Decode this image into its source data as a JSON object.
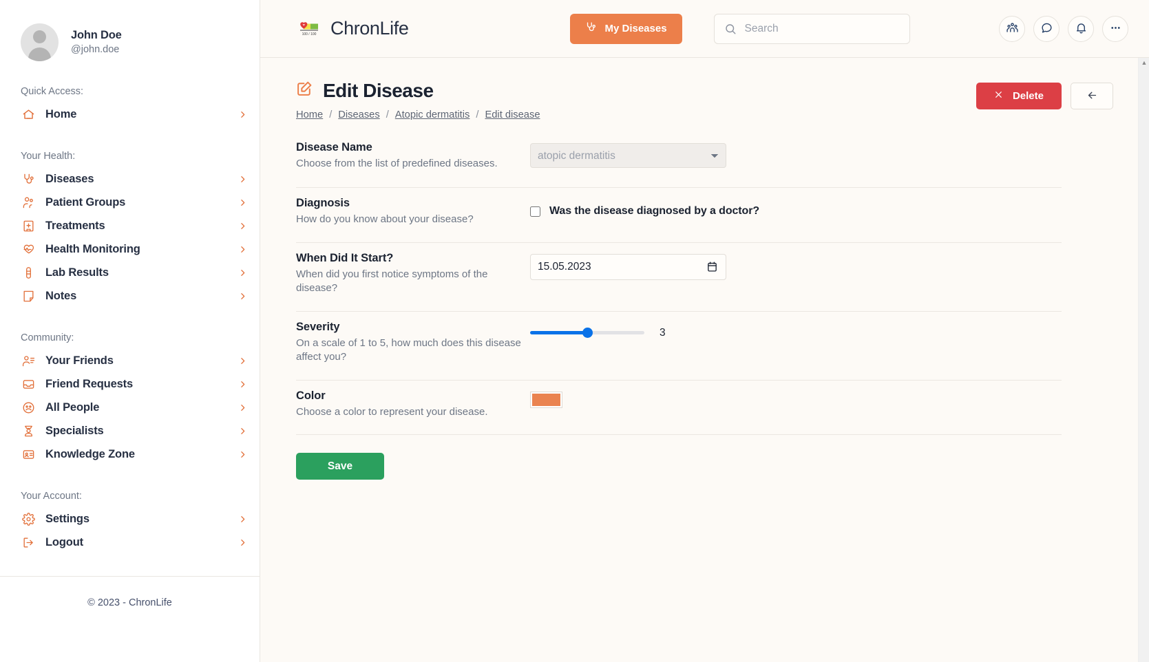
{
  "sidebar": {
    "profile": {
      "name": "John Doe",
      "handle": "@john.doe"
    },
    "groups": [
      {
        "label": "Quick Access:",
        "items": [
          {
            "label": "Home",
            "icon": "home-icon"
          }
        ]
      },
      {
        "label": "Your Health:",
        "items": [
          {
            "label": "Diseases",
            "icon": "stethoscope-icon"
          },
          {
            "label": "Patient Groups",
            "icon": "users-icon"
          },
          {
            "label": "Treatments",
            "icon": "hospital-icon"
          },
          {
            "label": "Health Monitoring",
            "icon": "heart-pulse-icon"
          },
          {
            "label": "Lab Results",
            "icon": "test-tube-icon"
          },
          {
            "label": "Notes",
            "icon": "note-icon"
          }
        ]
      },
      {
        "label": "Community:",
        "items": [
          {
            "label": "Your Friends",
            "icon": "user-list-icon"
          },
          {
            "label": "Friend Requests",
            "icon": "inbox-icon"
          },
          {
            "label": "All People",
            "icon": "globe-people-icon"
          },
          {
            "label": "Specialists",
            "icon": "doctor-icon"
          },
          {
            "label": "Knowledge Zone",
            "icon": "id-card-icon"
          }
        ]
      },
      {
        "label": "Your Account:",
        "items": [
          {
            "label": "Settings",
            "icon": "gear-icon"
          },
          {
            "label": "Logout",
            "icon": "logout-icon"
          }
        ]
      }
    ],
    "footer": "© 2023 - ChronLife"
  },
  "topbar": {
    "brand": "ChronLife",
    "logo_icon": "heart-healthbar-icon",
    "logo_caption": "100 / 100",
    "my_diseases_label": "My Diseases",
    "my_diseases_icon": "stethoscope-icon",
    "search": {
      "placeholder": "Search",
      "value": ""
    },
    "actions": [
      {
        "icon": "people-icon",
        "name": "people-button"
      },
      {
        "icon": "chat-bubble-icon",
        "name": "messages-button"
      },
      {
        "icon": "bell-icon",
        "name": "notifications-button"
      },
      {
        "icon": "ellipsis-icon",
        "name": "more-button"
      }
    ]
  },
  "page": {
    "title": "Edit Disease",
    "title_icon": "edit-square-icon",
    "breadcrumb": [
      {
        "label": "Home"
      },
      {
        "label": "Diseases"
      },
      {
        "label": "Atopic dermatitis"
      },
      {
        "label": "Edit disease"
      }
    ],
    "breadcrumb_separator": "/",
    "delete_label": "Delete",
    "delete_icon": "close-icon",
    "back_icon": "arrow-left-icon",
    "save_label": "Save"
  },
  "form": {
    "rows": [
      {
        "label": "Disease Name",
        "hint": "Choose from the list of predefined diseases.",
        "type": "select",
        "value": "atopic dermatitis"
      },
      {
        "label": "Diagnosis",
        "hint": "How do you know about your disease?",
        "type": "checkbox",
        "checkbox_label": "Was the disease diagnosed by a doctor?",
        "checked": false
      },
      {
        "label": "When Did It Start?",
        "hint": "When did you first notice symptoms of the disease?",
        "type": "date",
        "value": "15.05.2023"
      },
      {
        "label": "Severity",
        "hint": "On a scale of 1 to 5, how much does this disease affect you?",
        "type": "range",
        "value": "3",
        "min": "1",
        "max": "5"
      },
      {
        "label": "Color",
        "hint": "Choose a color to represent your disease.",
        "type": "color",
        "value": "#ea8350"
      }
    ]
  },
  "colors": {
    "accent": "#ec7f4a",
    "danger": "#dc3f45",
    "success": "#2ba05e",
    "slider": "#0a72e8",
    "disease": "#ea8350"
  }
}
